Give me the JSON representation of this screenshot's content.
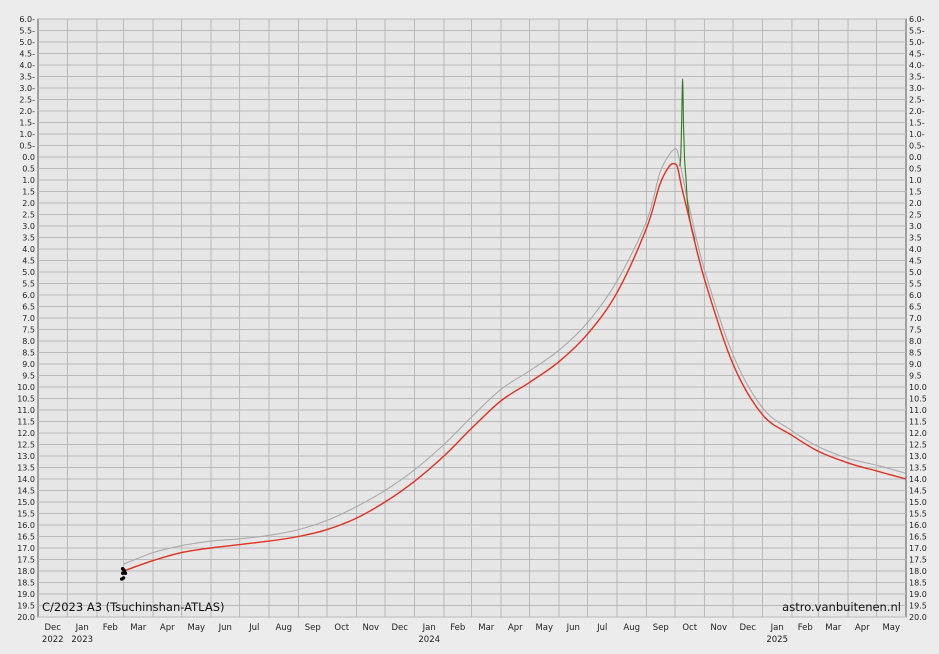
{
  "chart_data": {
    "type": "line",
    "title": "C/2023 A3 (Tsuchinshan-ATLAS)",
    "credit": "astro.vanbuitenen.nl",
    "ylim": [
      20.0,
      -6.0
    ],
    "y_inverted": true,
    "grid": true,
    "y_ticks": [
      "6.0-",
      "5.5-",
      "5.0-",
      "4.5-",
      "4.0-",
      "3.5-",
      "3.0-",
      "2.5-",
      "2.0-",
      "1.5-",
      "1.0-",
      "0.5-",
      "0.0",
      "0.5",
      "1.0",
      "1.5",
      "2.0",
      "2.5",
      "3.0",
      "3.5",
      "4.0",
      "4.5",
      "5.0",
      "5.5",
      "6.0",
      "6.5",
      "7.0",
      "7.5",
      "8.0",
      "8.5",
      "9.0",
      "9.5",
      "10.0",
      "10.5",
      "11.0",
      "11.5",
      "12.0",
      "12.5",
      "13.0",
      "13.5",
      "14.0",
      "14.5",
      "15.0",
      "15.5",
      "16.0",
      "16.5",
      "17.0",
      "17.5",
      "18.0",
      "18.5",
      "19.0",
      "19.5",
      "20.0"
    ],
    "x_months": [
      "Dec",
      "Jan",
      "Feb",
      "Mar",
      "Apr",
      "May",
      "Jun",
      "Jul",
      "Aug",
      "Sep",
      "Oct",
      "Nov",
      "Dec",
      "Jan",
      "Feb",
      "Mar",
      "Apr",
      "May",
      "Jun",
      "Jul",
      "Aug",
      "Sep",
      "Oct",
      "Nov",
      "Dec",
      "Jan",
      "Feb",
      "Mar",
      "Apr",
      "May"
    ],
    "x_years": [
      {
        "label": "2022",
        "month_index": 0
      },
      {
        "label": "2023",
        "month_index": 1
      },
      {
        "label": "2024",
        "month_index": 13
      },
      {
        "label": "2025",
        "month_index": 25
      }
    ],
    "series": [
      {
        "color": "#aaaaaa",
        "x": [
          "2023-03-01",
          "2023-04-01",
          "2023-05-01",
          "2023-06-01",
          "2023-07-01",
          "2023-08-01",
          "2023-09-01",
          "2023-10-01",
          "2023-11-01",
          "2023-12-01",
          "2024-01-01",
          "2024-02-01",
          "2024-03-01",
          "2024-04-01",
          "2024-05-01",
          "2024-06-01",
          "2024-07-01",
          "2024-08-01",
          "2024-09-01",
          "2024-09-15",
          "2024-09-25",
          "2024-10-01",
          "2024-10-04",
          "2024-10-08",
          "2024-10-15",
          "2024-11-01",
          "2024-12-01",
          "2025-01-01",
          "2025-02-01",
          "2025-03-01",
          "2025-04-01",
          "2025-05-01",
          "2025-06-01"
        ],
        "y": [
          17.7,
          17.2,
          16.9,
          16.7,
          16.6,
          16.45,
          16.2,
          15.8,
          15.2,
          14.5,
          13.6,
          12.5,
          11.3,
          10.1,
          9.3,
          8.4,
          7.2,
          5.4,
          2.8,
          0.7,
          -0.1,
          -0.35,
          -0.2,
          0.6,
          2.0,
          4.9,
          8.6,
          10.9,
          11.9,
          12.6,
          13.1,
          13.4,
          13.75
        ]
      },
      {
        "color": "#2e7d1f",
        "x": [
          "2024-10-06",
          "2024-10-07",
          "2024-10-08",
          "2024-10-09",
          "2024-10-10",
          "2024-10-11",
          "2024-10-12",
          "2024-10-13",
          "2024-10-14",
          "2024-10-17",
          "2024-10-22"
        ],
        "y": [
          0.4,
          0.0,
          -1.4,
          -3.4,
          -1.4,
          0.0,
          0.6,
          1.2,
          1.9,
          2.8,
          3.6
        ]
      },
      {
        "color": "#e03020",
        "x": [
          "2023-03-01",
          "2023-04-01",
          "2023-05-01",
          "2023-06-01",
          "2023-07-01",
          "2023-08-01",
          "2023-09-01",
          "2023-10-01",
          "2023-11-01",
          "2023-12-01",
          "2024-01-01",
          "2024-02-01",
          "2024-03-01",
          "2024-04-01",
          "2024-05-01",
          "2024-06-01",
          "2024-07-01",
          "2024-08-01",
          "2024-09-01",
          "2024-09-15",
          "2024-09-25",
          "2024-10-01",
          "2024-10-04",
          "2024-10-08",
          "2024-10-15",
          "2024-11-01",
          "2024-12-01",
          "2025-01-01",
          "2025-02-01",
          "2025-03-01",
          "2025-04-01",
          "2025-05-01",
          "2025-06-01"
        ],
        "y": [
          18.0,
          17.55,
          17.2,
          17.0,
          16.85,
          16.7,
          16.5,
          16.2,
          15.7,
          15.0,
          14.1,
          13.0,
          11.8,
          10.6,
          9.8,
          8.9,
          7.7,
          5.9,
          3.1,
          1.2,
          0.4,
          0.3,
          0.5,
          1.3,
          2.5,
          5.3,
          9.0,
          11.2,
          12.1,
          12.8,
          13.3,
          13.65,
          14.0
        ]
      }
    ],
    "observations": {
      "color": "#000000",
      "x": [
        "2023-02-28",
        "2023-02-28",
        "2023-03-01",
        "2023-03-02",
        "2023-03-03",
        "2023-02-27",
        "2023-03-01"
      ],
      "y": [
        17.9,
        18.1,
        18.3,
        18.0,
        18.1,
        18.35,
        17.95
      ]
    }
  }
}
